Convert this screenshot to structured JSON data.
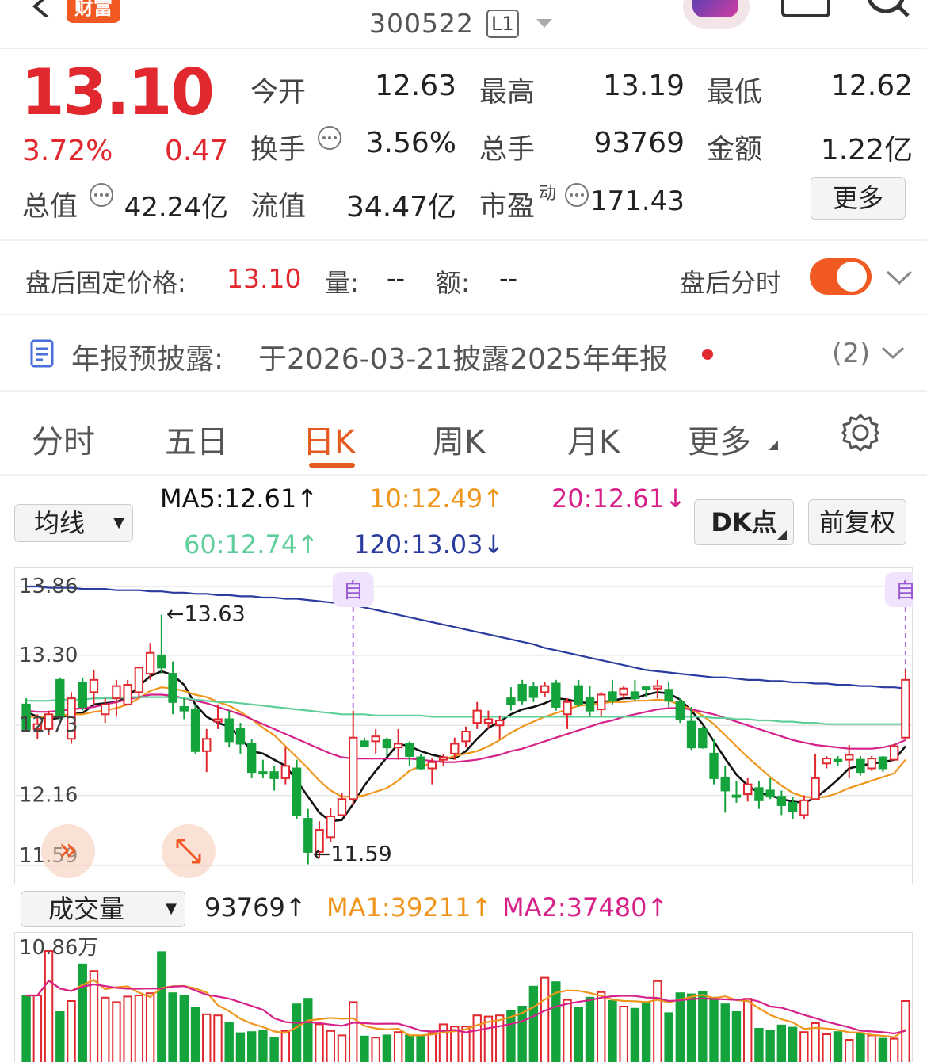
{
  "header": {
    "badge": "财富",
    "code": "300522",
    "level": "L1"
  },
  "quote": {
    "price": "13.10",
    "change_pct": "3.72%",
    "change": "0.47",
    "stats": [
      {
        "label": "今开",
        "value": "12.63",
        "color": "#222"
      },
      {
        "label": "最高",
        "value": "13.19",
        "color": "#e0282e"
      },
      {
        "label": "最低",
        "value": "12.62",
        "color": "#15a33c"
      },
      {
        "label": "换手",
        "value": "3.56%",
        "color": "#222"
      },
      {
        "label": "总手",
        "value": "93769",
        "color": "#222"
      },
      {
        "label": "金额",
        "value": "1.22亿",
        "color": "#222"
      },
      {
        "label": "总值",
        "value": "42.24亿",
        "color": "#222"
      },
      {
        "label": "流值",
        "value": "34.47亿",
        "color": "#222"
      },
      {
        "label": "市盈",
        "label_sup": "动",
        "value": "171.43",
        "color": "#222"
      }
    ],
    "more": "更多"
  },
  "afterhours": {
    "label": "盘后固定价格:",
    "price": "13.10",
    "vol_label": "量:",
    "vol": "--",
    "amt_label": "额:",
    "amt": "--",
    "toggle_label": "盘后分时",
    "toggle_on": true
  },
  "notice": {
    "label": "年报预披露:",
    "text": "于2026-03-21披露2025年年报",
    "count": "(2)"
  },
  "tabs": [
    "分时",
    "五日",
    "日K",
    "周K",
    "月K",
    "更多"
  ],
  "active_tab": "日K",
  "ma_bar": {
    "select": "均线",
    "ma5": "MA5:12.61↑",
    "ma10": "10:12.49↑",
    "ma20": "20:12.61↓",
    "ma60": "60:12.74↑",
    "ma120": "120:13.03↓",
    "dk": "DK点",
    "fq": "前复权"
  },
  "colors": {
    "up": "#e0282e",
    "down": "#15a33c",
    "ma5": "#111111",
    "ma10": "#f0951c",
    "ma20": "#d6218a",
    "ma60": "#5fcf9a",
    "ma120": "#2a3c9e",
    "accent": "#e55a1f"
  },
  "chart_data": {
    "type": "candlestick",
    "y_ticks": [
      "13.86",
      "13.30",
      "12.73",
      "12.16",
      "11.59"
    ],
    "ylim": [
      11.59,
      13.86
    ],
    "high_label": "←13.63",
    "low_label": "←11.59",
    "marker": "自",
    "candles": [
      [
        12.9,
        12.95,
        12.75,
        12.7
      ],
      [
        12.7,
        12.82,
        12.62,
        12.74
      ],
      [
        12.7,
        12.85,
        12.65,
        12.82
      ],
      [
        13.1,
        13.12,
        12.78,
        12.8
      ],
      [
        12.62,
        13.0,
        12.58,
        12.95
      ],
      [
        13.08,
        13.12,
        12.85,
        12.88
      ],
      [
        13.0,
        13.18,
        12.9,
        13.1
      ],
      [
        12.82,
        12.95,
        12.75,
        12.9
      ],
      [
        12.95,
        13.1,
        12.8,
        13.05
      ],
      [
        12.9,
        13.1,
        12.9,
        13.06
      ],
      [
        13.0,
        13.2,
        12.95,
        13.2
      ],
      [
        13.15,
        13.4,
        13.1,
        13.32
      ],
      [
        13.3,
        13.63,
        13.15,
        13.2
      ],
      [
        13.15,
        13.25,
        12.82,
        12.92
      ],
      [
        12.88,
        12.95,
        12.78,
        12.85
      ],
      [
        12.86,
        12.9,
        12.5,
        12.52
      ],
      [
        12.52,
        12.7,
        12.35,
        12.62
      ],
      [
        12.76,
        12.9,
        12.7,
        12.78
      ],
      [
        12.78,
        12.85,
        12.55,
        12.6
      ],
      [
        12.7,
        12.75,
        12.5,
        12.58
      ],
      [
        12.58,
        12.62,
        12.3,
        12.35
      ],
      [
        12.35,
        12.45,
        12.3,
        12.34
      ],
      [
        12.35,
        12.4,
        12.2,
        12.3
      ],
      [
        12.3,
        12.55,
        12.25,
        12.4
      ],
      [
        12.38,
        12.45,
        11.97,
        12.0
      ],
      [
        11.97,
        12.05,
        11.6,
        11.7
      ],
      [
        11.7,
        11.95,
        11.65,
        11.88
      ],
      [
        11.82,
        12.06,
        11.78,
        11.99
      ],
      [
        12.0,
        12.18,
        12.0,
        12.13
      ],
      [
        12.13,
        12.85,
        12.08,
        12.63
      ],
      [
        12.6,
        12.63,
        12.55,
        12.56
      ],
      [
        12.6,
        12.7,
        12.5,
        12.64
      ],
      [
        12.61,
        12.63,
        12.48,
        12.55
      ],
      [
        12.55,
        12.7,
        12.45,
        12.58
      ],
      [
        12.58,
        12.6,
        12.4,
        12.48
      ],
      [
        12.47,
        12.5,
        12.37,
        12.38
      ],
      [
        12.38,
        12.46,
        12.25,
        12.43
      ],
      [
        12.45,
        12.5,
        12.4,
        12.47
      ],
      [
        12.5,
        12.63,
        12.45,
        12.58
      ],
      [
        12.6,
        12.72,
        12.55,
        12.68
      ],
      [
        12.75,
        12.92,
        12.7,
        12.85
      ],
      [
        12.75,
        12.85,
        12.7,
        12.78
      ],
      [
        12.73,
        12.81,
        12.62,
        12.77
      ],
      [
        12.95,
        13.04,
        12.85,
        12.9
      ],
      [
        13.06,
        13.1,
        12.9,
        12.93
      ],
      [
        13.04,
        13.08,
        12.92,
        12.96
      ],
      [
        13.0,
        13.08,
        12.96,
        13.05
      ],
      [
        13.07,
        13.1,
        12.85,
        12.88
      ],
      [
        12.82,
        12.95,
        12.7,
        12.92
      ],
      [
        13.05,
        13.1,
        12.88,
        12.9
      ],
      [
        12.95,
        13.05,
        12.8,
        12.85
      ],
      [
        12.86,
        13.0,
        12.8,
        12.98
      ],
      [
        13.0,
        13.1,
        12.9,
        12.93
      ],
      [
        12.98,
        13.05,
        12.95,
        13.03
      ],
      [
        13.0,
        13.1,
        12.93,
        12.95
      ],
      [
        13.04,
        13.05,
        12.96,
        13.03
      ],
      [
        13.03,
        13.1,
        12.95,
        13.05
      ],
      [
        13.02,
        13.08,
        12.88,
        12.93
      ],
      [
        12.92,
        12.95,
        12.75,
        12.78
      ],
      [
        12.76,
        12.88,
        12.53,
        12.55
      ],
      [
        12.7,
        12.72,
        12.54,
        12.55
      ],
      [
        12.5,
        12.62,
        12.25,
        12.3
      ],
      [
        12.3,
        12.4,
        12.02,
        12.2
      ],
      [
        12.16,
        12.28,
        12.1,
        12.15
      ],
      [
        12.17,
        12.3,
        12.11,
        12.25
      ],
      [
        12.22,
        12.28,
        12.05,
        12.12
      ],
      [
        12.2,
        12.3,
        12.13,
        12.15
      ],
      [
        12.15,
        12.2,
        12.0,
        12.08
      ],
      [
        12.1,
        12.15,
        11.97,
        12.03
      ],
      [
        12.0,
        12.16,
        11.97,
        12.12
      ],
      [
        12.13,
        12.5,
        12.12,
        12.3
      ],
      [
        12.42,
        12.48,
        12.38,
        12.46
      ],
      [
        12.45,
        12.48,
        12.4,
        12.44
      ],
      [
        12.45,
        12.57,
        12.3,
        12.49
      ],
      [
        12.45,
        12.48,
        12.32,
        12.35
      ],
      [
        12.38,
        12.48,
        12.36,
        12.46
      ],
      [
        12.47,
        12.48,
        12.35,
        12.38
      ],
      [
        12.45,
        12.58,
        12.45,
        12.56
      ],
      [
        12.63,
        13.19,
        12.62,
        13.1
      ]
    ],
    "series": [
      {
        "name": "MA5",
        "color": "#111111",
        "values": [
          12.84,
          12.8,
          12.78,
          12.79,
          12.82,
          12.83,
          12.9,
          12.91,
          12.92,
          12.96,
          13.05,
          13.13,
          13.17,
          13.14,
          13.06,
          12.9,
          12.8,
          12.75,
          12.72,
          12.63,
          12.52,
          12.5,
          12.45,
          12.4,
          12.28,
          12.15,
          12.02,
          11.95,
          11.96,
          12.09,
          12.24,
          12.36,
          12.47,
          12.58,
          12.56,
          12.52,
          12.49,
          12.47,
          12.46,
          12.52,
          12.62,
          12.71,
          12.76,
          12.82,
          12.86,
          12.88,
          12.91,
          12.95,
          12.94,
          12.92,
          12.91,
          12.92,
          12.93,
          12.95,
          12.95,
          12.98,
          13.0,
          12.99,
          12.94,
          12.85,
          12.74,
          12.6,
          12.46,
          12.33,
          12.24,
          12.18,
          12.16,
          12.13,
          12.11,
          12.1,
          12.14,
          12.21,
          12.29,
          12.38,
          12.4,
          12.42,
          12.43,
          12.45,
          12.56
        ]
      },
      {
        "name": "MA10",
        "color": "#f0951c",
        "values": [
          12.8,
          12.8,
          12.8,
          12.81,
          12.82,
          12.82,
          12.84,
          12.85,
          12.87,
          12.9,
          12.95,
          13.01,
          13.04,
          13.03,
          13.01,
          12.98,
          12.96,
          12.92,
          12.89,
          12.84,
          12.78,
          12.71,
          12.65,
          12.56,
          12.47,
          12.38,
          12.28,
          12.2,
          12.15,
          12.15,
          12.16,
          12.19,
          12.22,
          12.28,
          12.36,
          12.4,
          12.42,
          12.45,
          12.48,
          12.5,
          12.52,
          12.56,
          12.61,
          12.67,
          12.72,
          12.76,
          12.8,
          12.83,
          12.86,
          12.89,
          12.9,
          12.91,
          12.92,
          12.92,
          12.93,
          12.93,
          12.94,
          12.93,
          12.9,
          12.86,
          12.81,
          12.74,
          12.65,
          12.56,
          12.47,
          12.39,
          12.31,
          12.24,
          12.18,
          12.15,
          12.14,
          12.15,
          12.18,
          12.22,
          12.25,
          12.28,
          12.31,
          12.34,
          12.45
        ]
      },
      {
        "name": "MA20",
        "color": "#d6218a",
        "values": [
          12.85,
          12.84,
          12.84,
          12.85,
          12.86,
          12.87,
          12.88,
          12.9,
          12.92,
          12.94,
          12.96,
          12.98,
          12.98,
          12.97,
          12.95,
          12.93,
          12.91,
          12.88,
          12.85,
          12.82,
          12.78,
          12.74,
          12.7,
          12.66,
          12.62,
          12.58,
          12.54,
          12.5,
          12.47,
          12.46,
          12.46,
          12.46,
          12.46,
          12.46,
          12.46,
          12.45,
          12.44,
          12.43,
          12.43,
          12.44,
          12.45,
          12.47,
          12.49,
          12.52,
          12.54,
          12.57,
          12.6,
          12.63,
          12.66,
          12.69,
          12.72,
          12.75,
          12.77,
          12.8,
          12.82,
          12.84,
          12.86,
          12.87,
          12.87,
          12.86,
          12.84,
          12.82,
          12.79,
          12.76,
          12.73,
          12.7,
          12.67,
          12.64,
          12.61,
          12.59,
          12.57,
          12.56,
          12.55,
          12.54,
          12.54,
          12.54,
          12.55,
          12.57,
          12.61
        ]
      },
      {
        "name": "MA60",
        "color": "#5fcf9a",
        "values": [
          12.93,
          12.93,
          12.93,
          12.94,
          12.94,
          12.94,
          12.95,
          12.95,
          12.95,
          12.96,
          12.96,
          12.96,
          12.96,
          12.96,
          12.95,
          12.94,
          12.93,
          12.92,
          12.92,
          12.91,
          12.9,
          12.89,
          12.88,
          12.87,
          12.86,
          12.85,
          12.84,
          12.83,
          12.82,
          12.82,
          12.82,
          12.81,
          12.81,
          12.81,
          12.81,
          12.81,
          12.8,
          12.8,
          12.8,
          12.8,
          12.8,
          12.8,
          12.8,
          12.8,
          12.8,
          12.8,
          12.8,
          12.8,
          12.8,
          12.8,
          12.8,
          12.8,
          12.8,
          12.8,
          12.8,
          12.8,
          12.8,
          12.8,
          12.8,
          12.8,
          12.8,
          12.79,
          12.79,
          12.78,
          12.78,
          12.77,
          12.77,
          12.76,
          12.76,
          12.75,
          12.75,
          12.74,
          12.74,
          12.74,
          12.74,
          12.74,
          12.74,
          12.74,
          12.74
        ]
      },
      {
        "name": "MA120",
        "color": "#2a3c9e",
        "values": [
          13.86,
          13.86,
          13.85,
          13.85,
          13.85,
          13.84,
          13.84,
          13.84,
          13.83,
          13.83,
          13.83,
          13.82,
          13.82,
          13.81,
          13.81,
          13.8,
          13.8,
          13.79,
          13.79,
          13.78,
          13.78,
          13.77,
          13.77,
          13.76,
          13.76,
          13.75,
          13.74,
          13.73,
          13.72,
          13.71,
          13.69,
          13.67,
          13.65,
          13.63,
          13.61,
          13.59,
          13.57,
          13.55,
          13.53,
          13.51,
          13.49,
          13.47,
          13.45,
          13.43,
          13.41,
          13.39,
          13.36,
          13.34,
          13.32,
          13.3,
          13.28,
          13.26,
          13.24,
          13.22,
          13.2,
          13.18,
          13.17,
          13.16,
          13.15,
          13.14,
          13.13,
          13.12,
          13.12,
          13.11,
          13.1,
          13.1,
          13.09,
          13.09,
          13.08,
          13.08,
          13.07,
          13.07,
          13.06,
          13.06,
          13.05,
          13.05,
          13.04,
          13.04,
          13.03
        ]
      }
    ]
  },
  "volume": {
    "select": "成交量",
    "value": "93769↑",
    "ma1": "MA1:39211↑",
    "ma2": "MA2:37480↑",
    "top_label": "10.86万",
    "values": [
      60,
      60,
      100,
      45,
      55,
      88,
      82,
      58,
      54,
      59,
      60,
      62,
      99,
      62,
      60,
      49,
      43,
      42,
      35,
      26,
      27,
      28,
      22,
      28,
      52,
      57,
      34,
      28,
      24,
      54,
      23,
      22,
      24,
      27,
      24,
      23,
      26,
      34,
      32,
      32,
      42,
      41,
      42,
      46,
      50,
      68,
      76,
      72,
      56,
      49,
      58,
      63,
      55,
      50,
      48,
      54,
      73,
      44,
      62,
      61,
      63,
      58,
      52,
      45,
      57,
      30,
      28,
      33,
      31,
      27,
      35,
      25,
      27,
      20,
      26,
      24,
      21,
      21,
      55
    ]
  }
}
